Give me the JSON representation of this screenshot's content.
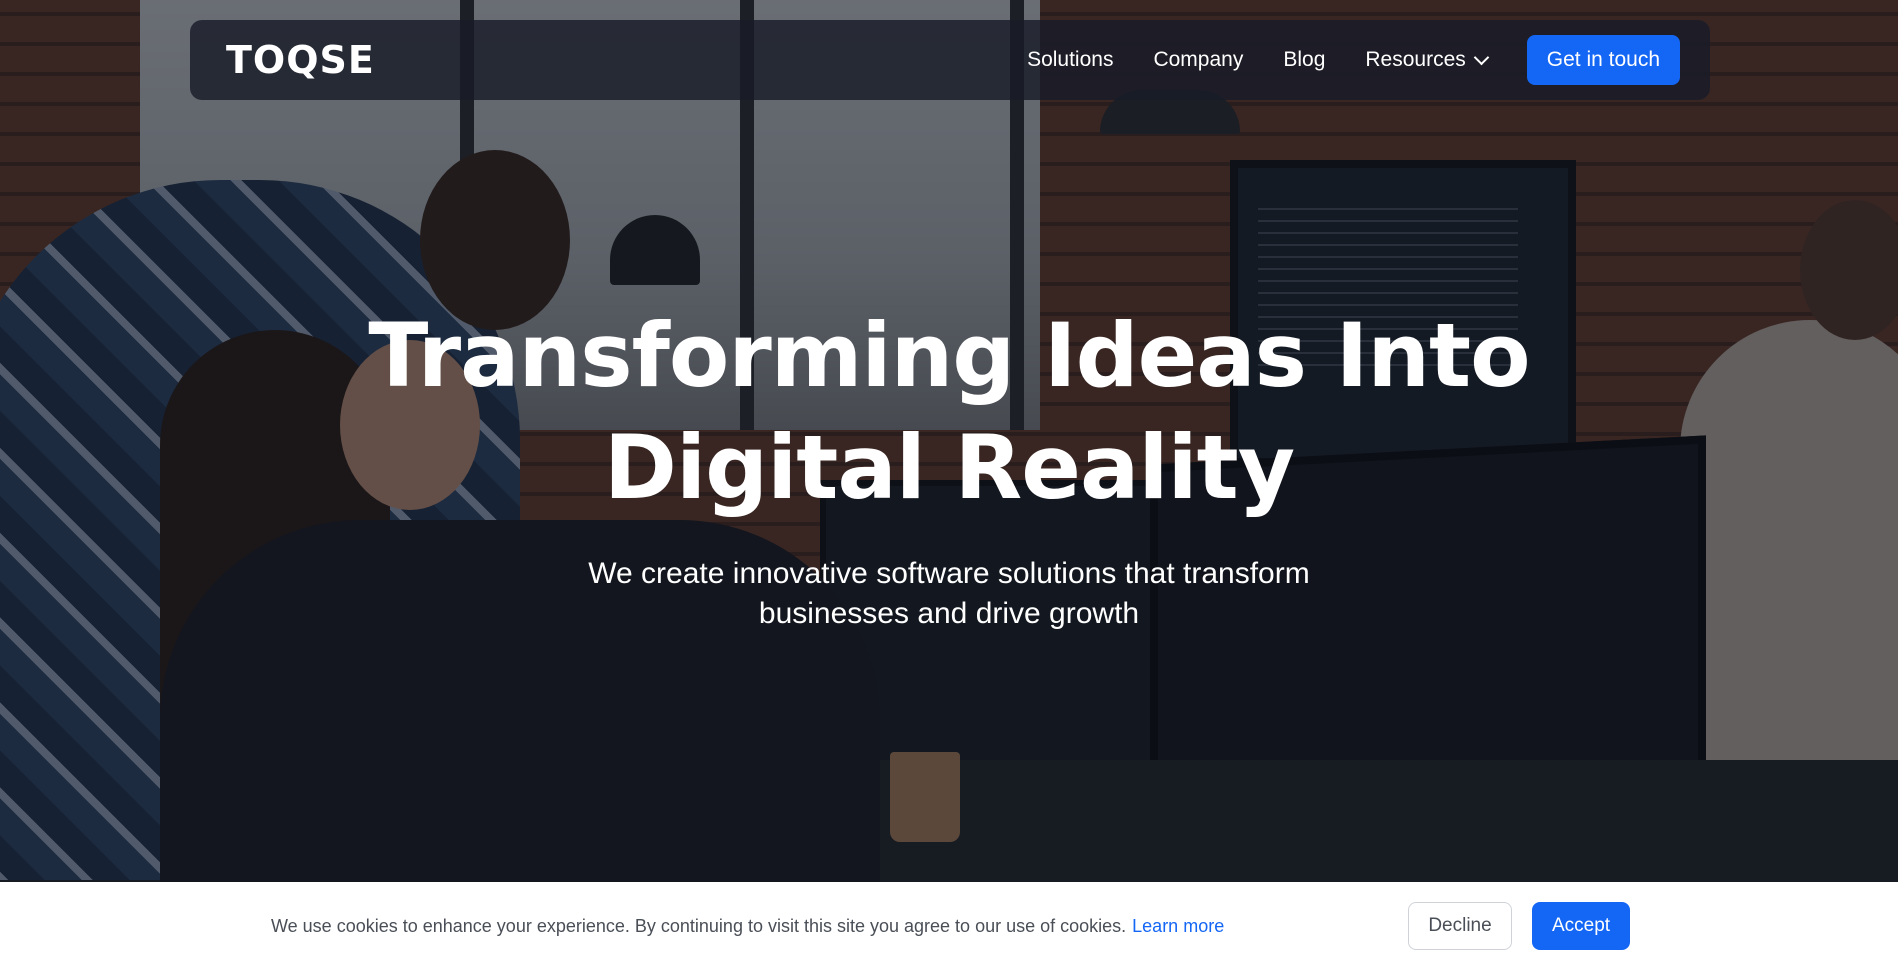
{
  "brand": {
    "logo_text": "TOQSE"
  },
  "nav": {
    "items": [
      {
        "label": "Solutions"
      },
      {
        "label": "Company"
      },
      {
        "label": "Blog"
      },
      {
        "label": "Resources",
        "has_dropdown": true
      }
    ],
    "cta_label": "Get in touch"
  },
  "hero": {
    "headline_line1": "Transforming Ideas Into",
    "headline_line2": "Digital Reality",
    "subline_line1": "We create innovative software solutions that transform",
    "subline_line2": "businesses and drive growth",
    "background_image": "office team working at computers"
  },
  "cookie_banner": {
    "message": "We use cookies to enhance your experience. By continuing to visit this site you agree to our use of cookies.",
    "link_label": "Learn more",
    "decline_label": "Decline",
    "accept_label": "Accept"
  },
  "colors": {
    "accent": "#1466f5",
    "navbar_bg": "#181c28",
    "cookie_text": "#4a4f57"
  }
}
